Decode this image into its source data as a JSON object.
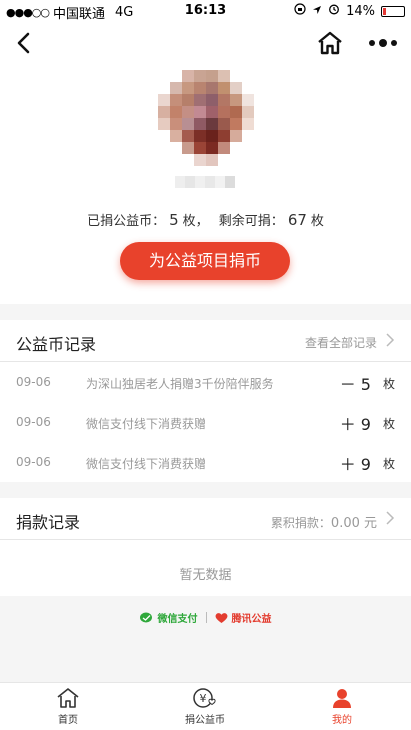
{
  "status_bar": {
    "signal": "●●●○○",
    "carrier": "中国联通",
    "network": "4G",
    "time": "16:13",
    "battery": "14%",
    "battery_level": 0.14
  },
  "stats": {
    "donated_label": "已捐公益币：",
    "donated_value": "5",
    "unit1": "枚，",
    "remaining_label": "剩余可捐：",
    "remaining_value": "67",
    "unit2": "枚"
  },
  "donate_button": "为公益项目捐币",
  "coin_records": {
    "title": "公益币记录",
    "view_all": "查看全部记录",
    "rows": [
      {
        "date": "09-06",
        "desc": "为深山独居老人捐赠3千份陪伴服务",
        "amount": "－ 5",
        "unit": "枚"
      },
      {
        "date": "09-06",
        "desc": "微信支付线下消费获赠",
        "amount": "＋ 9",
        "unit": "枚"
      },
      {
        "date": "09-06",
        "desc": "微信支付线下消费获赠",
        "amount": "＋ 9",
        "unit": "枚"
      }
    ]
  },
  "donation_records": {
    "title": "捐款记录",
    "total_label": "累积捐款：",
    "total_value": "0.00 元",
    "empty_text": "暂无数据"
  },
  "footer": {
    "wechat_pay": "微信支付",
    "tencent_charity": "腾讯公益"
  },
  "tabs": [
    {
      "label": "首页",
      "icon": "home-icon"
    },
    {
      "label": "捐公益币",
      "icon": "coin-heart-icon"
    },
    {
      "label": "我的",
      "icon": "user-icon"
    }
  ],
  "colors": {
    "accent": "#e8422c",
    "wechat_green": "#2fa83b"
  }
}
